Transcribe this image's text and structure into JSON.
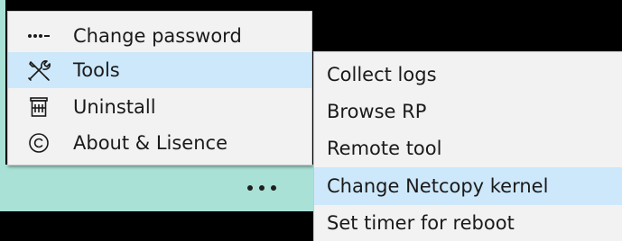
{
  "more_button": {
    "icon": "more-dots-icon"
  },
  "main_menu": {
    "items": [
      {
        "label": "Change password",
        "icon": "password-dots-icon",
        "highlighted": false
      },
      {
        "label": "Tools",
        "icon": "tools-icon",
        "highlighted": true
      },
      {
        "label": "Uninstall",
        "icon": "trash-icon",
        "highlighted": false
      },
      {
        "label": "About & Lisence",
        "icon": "copyright-icon",
        "highlighted": false
      }
    ]
  },
  "submenu": {
    "items": [
      {
        "label": "Collect logs",
        "highlighted": false
      },
      {
        "label": "Browse RP",
        "highlighted": false
      },
      {
        "label": "Remote tool",
        "highlighted": false
      },
      {
        "label": "Change Netcopy kernel",
        "highlighted": true
      },
      {
        "label": "Set timer for reboot",
        "highlighted": false
      }
    ]
  },
  "colors": {
    "menu_background": "#f2f2f2",
    "highlight": "#cde8fa",
    "teal_bar": "#a9e1d6",
    "backdrop": "#000000"
  }
}
